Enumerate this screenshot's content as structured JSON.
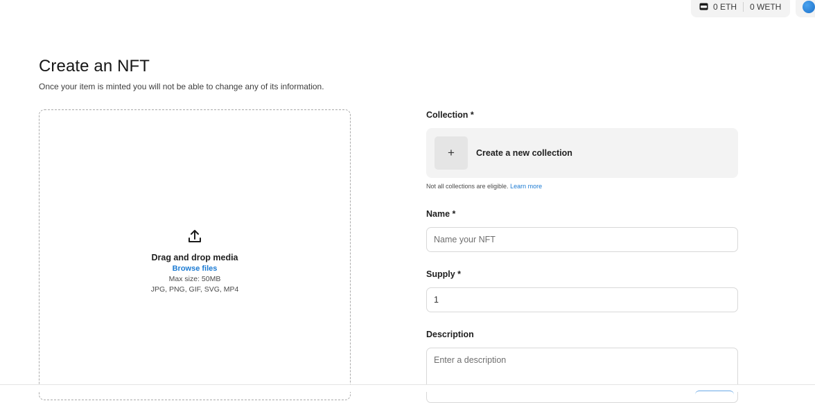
{
  "wallet": {
    "eth": "0 ETH",
    "weth": "0 WETH",
    "icon": "wallet-icon"
  },
  "header": {
    "title": "Create an NFT",
    "subtitle": "Once your item is minted you will not be able to change any of its information."
  },
  "upload": {
    "icon": "upload-icon",
    "title": "Drag and drop media",
    "browse_label": "Browse files",
    "max_size": "Max size: 50MB",
    "formats": "JPG, PNG, GIF, SVG, MP4"
  },
  "form": {
    "collection": {
      "label": "Collection *",
      "create_label": "Create a new collection",
      "plus_glyph": "+",
      "hint_text": "Not all collections are eligible.",
      "learn_more": "Learn more"
    },
    "name": {
      "label": "Name *",
      "placeholder": "Name your NFT",
      "value": ""
    },
    "supply": {
      "label": "Supply *",
      "value": "1"
    },
    "description": {
      "label": "Description",
      "placeholder": "Enter a description",
      "value": ""
    }
  },
  "colors": {
    "accent": "#1c7bd3",
    "card_bg": "#f3f3f3"
  }
}
